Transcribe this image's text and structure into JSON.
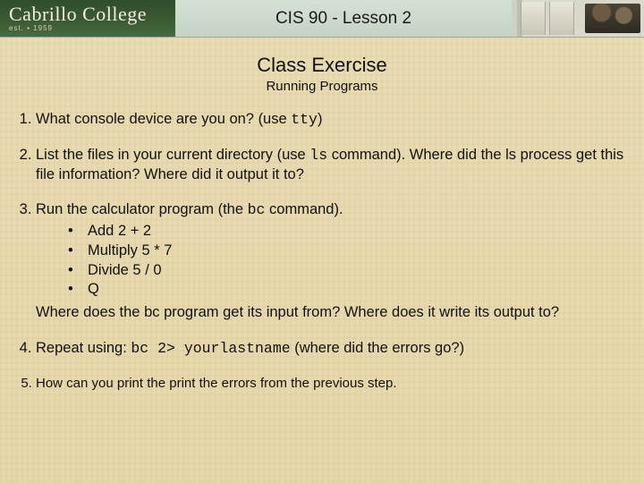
{
  "header": {
    "logo_line1": "Cabrillo College",
    "logo_est": "est. ▪ 1959",
    "course_title": "CIS 90 - Lesson 2"
  },
  "exercise": {
    "title": "Class Exercise",
    "subtitle": "Running Programs"
  },
  "q1": {
    "a": "What console device are you on? (use ",
    "cmd": "tty",
    "b": ")"
  },
  "q2": {
    "a": "List the files in your current directory (use ",
    "cmd": "ls",
    "b": " command).   Where did the ls process get this file information?  Where did it output it to?"
  },
  "q3": {
    "a": "Run the calculator program (the ",
    "cmd": "bc",
    "b": " command).",
    "sub": [
      "Add 2 + 2",
      "Multiply 5 * 7",
      "Divide 5 / 0",
      "Q"
    ],
    "tail": "Where does the bc program get its input from? Where does it write its output to?"
  },
  "q4": {
    "a": "Repeat using:  ",
    "cmd": "bc 2> yourlastname",
    "b": "  (where did the errors go?)"
  },
  "q5": {
    "a": "How can you print the print the errors from the previous step."
  }
}
